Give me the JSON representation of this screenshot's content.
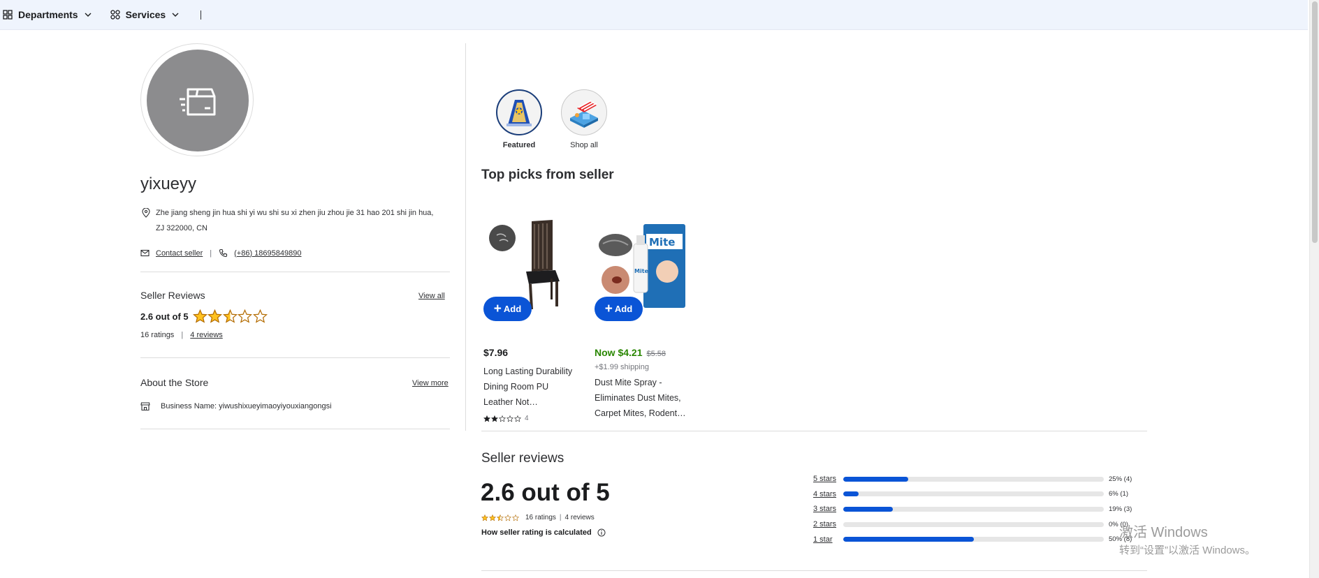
{
  "topnav": {
    "departments": "Departments",
    "services": "Services"
  },
  "seller": {
    "name": "yixueyy",
    "address": "Zhe jiang sheng jin hua shi yi wu shi su xi zhen jiu zhou jie 31 hao 201 shi jin hua, ZJ 322000, CN",
    "contact_label": "Contact seller",
    "phone": "(+86) 18695849890"
  },
  "seller_reviews_panel": {
    "title": "Seller Reviews",
    "view_all": "View all",
    "rating_text": "2.6 out of 5",
    "rating_value": 2.6,
    "ratings_count": "16 ratings",
    "separator": "|",
    "reviews_link": "4 reviews"
  },
  "about": {
    "title": "About the Store",
    "view_more": "View more",
    "business_name": "Business Name: yiwushixueyimaoyiyouxiangongsi"
  },
  "tabs": [
    {
      "label": "Featured",
      "active": true
    },
    {
      "label": "Shop all",
      "active": false
    }
  ],
  "top_picks": {
    "title": "Top picks from seller",
    "add_label": "Add",
    "products": [
      {
        "price": "$7.96",
        "title": "Long Lasting Durability Dining Room PU Leather Not…",
        "stars": 2,
        "review_count": "4"
      },
      {
        "price_now": "Now $4.21",
        "price_was": "$5.58",
        "shipping": "+$1.99 shipping",
        "title": "Dust Mite Spray - Eliminates Dust Mites, Carpet Mites, Rodent…"
      }
    ]
  },
  "seller_reviews_section": {
    "title": "Seller reviews",
    "big_rating": "2.6 out of 5",
    "ratings": "16 ratings",
    "separator": "|",
    "reviews": "4 reviews",
    "how_calculated": "How seller rating is calculated",
    "distribution": [
      {
        "label": "5 stars",
        "percent": 25,
        "text": "25% (4)"
      },
      {
        "label": "4 stars",
        "percent": 6,
        "text": "6% (1)"
      },
      {
        "label": "3 stars",
        "percent": 19,
        "text": "19% (3)"
      },
      {
        "label": "2 stars",
        "percent": 0,
        "text": "0% (0)"
      },
      {
        "label": "1 star",
        "percent": 50,
        "text": "50% (8)"
      }
    ]
  },
  "watermark": {
    "line1": "激活 Windows",
    "line2": "转到“设置”以激活 Windows。"
  },
  "colors": {
    "topbar_bg": "#eff4fd",
    "primary_blue": "#0a54d6",
    "star_gold": "#ffc220",
    "now_price_green": "#2a8703"
  }
}
